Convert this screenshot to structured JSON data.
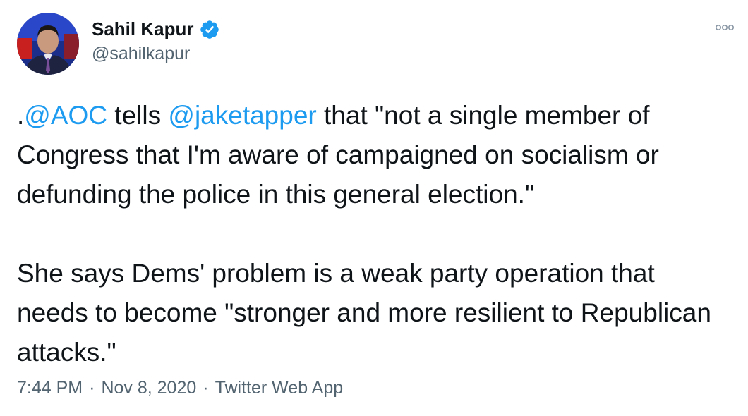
{
  "author": {
    "display_name": "Sahil Kapur",
    "handle": "@sahilkapur",
    "verified_icon": "verified-badge-icon",
    "verified_color": "#1d9bf0"
  },
  "tweet": {
    "line1": {
      "prefix": ".",
      "mention1": "@AOC",
      "mid": " tells ",
      "mention2": "@jaketapper",
      "suffix": " that \"not a single member of Congress that I'm aware of campaigned on socialism or defunding the police in this general election.\""
    },
    "paragraph2": "She says Dems' problem is a weak party operation that needs to become \"stronger and more resilient to Republican attacks.\""
  },
  "meta": {
    "time": "7:44 PM",
    "separator": "·",
    "date": "Nov 8, 2020",
    "source": "Twitter Web App"
  },
  "icons": {
    "more": "more-options-icon"
  },
  "colors": {
    "link": "#1d9bf0",
    "secondary_text": "#536471",
    "primary_text": "#0f1419"
  }
}
